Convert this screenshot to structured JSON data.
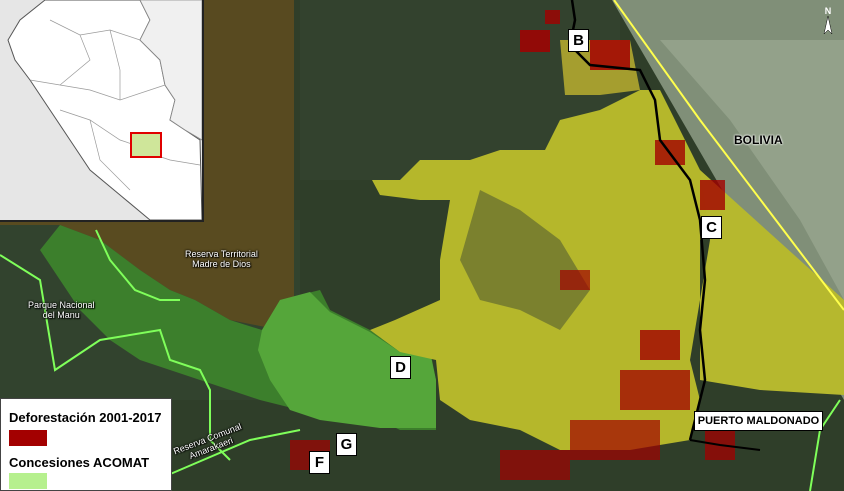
{
  "colors": {
    "forest_dark": "#2d3b27",
    "reserve_brown": "#5b4a1d",
    "concession": "#b8b92e",
    "protected_green": "#55a63a",
    "deforestation": "#a30000",
    "bolivia_haze": "#9fae96",
    "border_yellow": "#ffff4d",
    "protected_border": "#7fff5a"
  },
  "markers": [
    "B",
    "C",
    "D",
    "F",
    "G"
  ],
  "place_labels": {
    "reserva_territorial": "Reserva Territorial\nMadre de Dios",
    "parque_manu": "Parque Nacional\ndel Manu",
    "reserva_comunal": "Reserva Comunal\nAmarakaeri",
    "bolivia": "BOLIVIA",
    "puerto_maldonado": "PUERTO MALDONADO"
  },
  "legend": {
    "deforestation_label": "Deforestación 2001-2017",
    "concessions_label": "Concesiones ACOMAT",
    "deforestation_color": "#a30000",
    "concessions_color": "#b6f08e"
  },
  "north_arrow": "N",
  "inset": {
    "land_color": "#ffffff",
    "ocean_color": "#e6e6e6",
    "highlight_color": "#cfe69a",
    "highlight_border": "#e00000"
  }
}
